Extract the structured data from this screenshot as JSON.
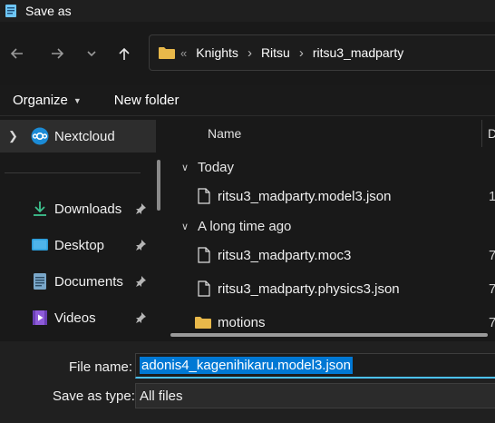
{
  "window": {
    "title": "Save as"
  },
  "nav": {
    "back_icon": "arrow-left-icon",
    "forward_icon": "arrow-right-icon",
    "recent_icon": "chevron-down-icon",
    "up_icon": "arrow-up-icon"
  },
  "address": {
    "overflow": "«",
    "crumbs": [
      "Knights",
      "Ritsu",
      "ritsu3_madparty"
    ]
  },
  "toolbar": {
    "organize_label": "Organize",
    "new_folder_label": "New folder"
  },
  "sidebar": {
    "items": [
      {
        "label": "Nextcloud",
        "icon": "nextcloud-icon"
      },
      {
        "label": "Downloads",
        "icon": "download-icon"
      },
      {
        "label": "Desktop",
        "icon": "desktop-icon"
      },
      {
        "label": "Documents",
        "icon": "documents-icon"
      },
      {
        "label": "Videos",
        "icon": "videos-icon"
      }
    ]
  },
  "columns": {
    "name": "Name",
    "date": "D"
  },
  "groups": [
    {
      "label": "Today",
      "files": [
        {
          "name": "ritsu3_madparty.model3.json",
          "date": "1"
        }
      ]
    },
    {
      "label": "A long time ago",
      "files": [
        {
          "name": "ritsu3_madparty.moc3",
          "date": "7"
        },
        {
          "name": "ritsu3_madparty.physics3.json",
          "date": "7"
        },
        {
          "name": "motions",
          "date": "7"
        }
      ]
    }
  ],
  "form": {
    "file_name_label": "File name:",
    "file_name_value": "adonis4_kagenihikaru.model3.json",
    "save_type_label": "Save as type:",
    "save_type_value": "All files"
  },
  "colors": {
    "accent": "#0078d4",
    "focus": "#4cc2ff",
    "folder": "#e8b84a"
  }
}
